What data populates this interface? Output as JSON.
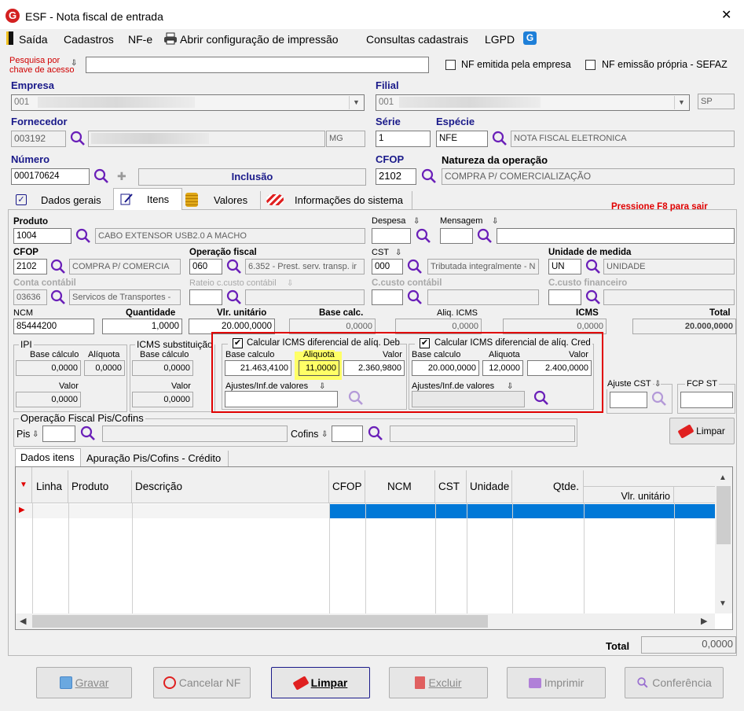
{
  "window": {
    "title": "ESF - Nota fiscal de entrada",
    "close": "✕"
  },
  "menu": [
    "Saída",
    "Cadastros",
    "NF-e",
    "Abrir configuração de impressão",
    "Consultas cadastrais",
    "LGPD"
  ],
  "search": {
    "label_line1": "Pesquisa por",
    "label_line2": "chave de acesso",
    "value": ""
  },
  "checks": {
    "nf_empresa": "NF emitida pela empresa",
    "nf_propria": "NF emissão própria - SEFAZ"
  },
  "header": {
    "empresa_label": "Empresa",
    "empresa_code": "001",
    "filial_label": "Filial",
    "filial_code": "001",
    "filial_uf": "SP",
    "fornecedor_label": "Fornecedor",
    "fornecedor_code": "003192",
    "fornecedor_uf": "MG",
    "serie_label": "Série",
    "serie": "1",
    "especie_label": "Espécie",
    "especie_code": "NFE",
    "especie_desc": "NOTA FISCAL ELETRONICA",
    "numero_label": "Número",
    "numero": "000170624",
    "status": "Inclusão",
    "cfop_label": "CFOP",
    "cfop": "2102",
    "natureza_label": "Natureza da operação",
    "natureza": "COMPRA P/ COMERCIALIZAÇÃO"
  },
  "tabs": [
    "Dados gerais",
    "Itens",
    "Valores",
    "Informações do sistema"
  ],
  "hint": "Pressione F8 para sair",
  "item": {
    "produto_label": "Produto",
    "produto_code": "1004",
    "produto_desc": "CABO EXTENSOR USB2.0 A MACHO",
    "despesa_label": "Despesa",
    "mensagem_label": "Mensagem",
    "cfop_label": "CFOP",
    "cfop": "2102",
    "cfop_desc": "COMPRA P/ COMERCIA",
    "operacao_label": "Operação fiscal",
    "operacao_code": "060",
    "operacao_desc": "6.352 - Prest. serv. transp. ir",
    "cst_label": "CST",
    "cst_code": "000",
    "cst_desc": "Tributada integralmente - N",
    "unidade_label": "Unidade de medida",
    "unidade_code": "UN",
    "unidade_desc": "UNIDADE",
    "conta_label": "Conta contábil",
    "conta_code": "03636",
    "conta_desc": "Servicos de Transportes -",
    "rateio_label": "Rateio c.custo contábil",
    "ccusto_label": "C.custo contábil",
    "ccusto_fin_label": "C.custo financeiro",
    "ncm_label": "NCM",
    "ncm": "85444200",
    "quantidade_label": "Quantidade",
    "quantidade": "1,0000",
    "vlr_unit_label": "Vlr. unitário",
    "vlr_unit": "20.000,0000",
    "base_calc_label": "Base calc.",
    "base_calc": "0,0000",
    "aliq_icms_label": "Aliq. ICMS",
    "aliq_icms": "0,0000",
    "icms_label": "ICMS",
    "icms": "0,0000",
    "total_label": "Total",
    "total": "20.000,0000"
  },
  "ipi": {
    "title": "IPI",
    "base_label": "Base cálculo",
    "base": "0,0000",
    "aliq_label": "Alíquota",
    "aliq": "0,0000",
    "valor_label": "Valor",
    "valor": "0,0000"
  },
  "icms_st": {
    "title": "ICMS substituição",
    "base_label": "Base cálculo",
    "base": "0,0000",
    "valor_label": "Valor",
    "valor": "0,0000"
  },
  "difal_deb": {
    "check_label": "Calcular ICMS diferencial de alíq. Deb",
    "base_label": "Base calculo",
    "base": "21.463,4100",
    "aliq_label": "Aliquota",
    "aliq": "11,0000",
    "valor_label": "Valor",
    "valor": "2.360,9800",
    "ajustes_label": "Ajustes/Inf.de valores"
  },
  "difal_cred": {
    "check_label": "Calcular ICMS diferencial de alíq. Cred",
    "base_label": "Base calculo",
    "base": "20.000,0000",
    "aliq_label": "Aliquota",
    "aliq": "12,0000",
    "valor_label": "Valor",
    "valor": "2.400,0000",
    "ajustes_label": "Ajustes/Inf.de valores"
  },
  "ajuste_cst_label": "Ajuste CST",
  "fcp_st_label": "FCP ST",
  "pis_cofins": {
    "title": "Operação Fiscal Pis/Cofins",
    "pis_label": "Pis",
    "cofins_label": "Cofins"
  },
  "limpar_small": "Limpar",
  "subtabs": [
    "Dados itens",
    "Apuração Pis/Cofins - Crédito"
  ],
  "grid": {
    "columns": [
      "Linha",
      "Produto",
      "Descrição",
      "CFOP",
      "NCM",
      "CST",
      "Unidade",
      "Qtde.",
      "Vlr. unitário"
    ]
  },
  "total_label": "Total",
  "total_value": "0,0000",
  "buttons": [
    "Gravar",
    "Cancelar NF",
    "Limpar",
    "Excluir",
    "Imprimir",
    "Conferência"
  ],
  "colors": {
    "accent": "#1a1a8a",
    "hint": "#e00000",
    "highlight_box": "#e00000",
    "selected_row": "#0078d7",
    "yellow": "#ffff66",
    "magnifier": "#6a1fb8"
  }
}
